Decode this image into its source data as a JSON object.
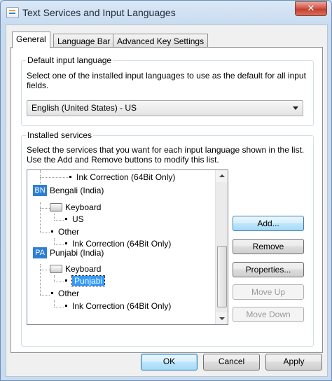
{
  "window": {
    "title": "Text Services and Input Languages",
    "close_glyph": "✕"
  },
  "tabs": [
    {
      "label": "General"
    },
    {
      "label": "Language Bar"
    },
    {
      "label": "Advanced Key Settings"
    }
  ],
  "default_input": {
    "group_label": "Default input language",
    "description": "Select one of the installed input languages to use as the default for all input fields.",
    "selected_value": "English (United States) - US"
  },
  "installed_services": {
    "group_label": "Installed services",
    "description_line1": "Select the services that you want for each input language shown in the list.",
    "description_line2": "Use the Add and Remove buttons to modify this list.",
    "tree": {
      "top_item": "Ink Correction (64Bit Only)",
      "bengali": {
        "badge": "BN",
        "name": "Bengali (India)",
        "keyboard": "Keyboard",
        "layout": "US",
        "other": "Other",
        "other_item": "Ink Correction (64Bit Only)"
      },
      "punjabi": {
        "badge": "PA",
        "name": "Punjabi (India)",
        "keyboard": "Keyboard",
        "layout": "Punjabi",
        "other": "Other",
        "other_item": "Ink Correction (64Bit Only)"
      }
    },
    "buttons": {
      "add": "Add...",
      "remove": "Remove",
      "properties": "Properties...",
      "move_up": "Move Up",
      "move_down": "Move Down"
    }
  },
  "dialog_buttons": {
    "ok": "OK",
    "cancel": "Cancel",
    "apply": "Apply"
  },
  "colors": {
    "selection": "#3399ff",
    "lang_badge": "#2e7fd3",
    "close_button": "#c4402f"
  }
}
